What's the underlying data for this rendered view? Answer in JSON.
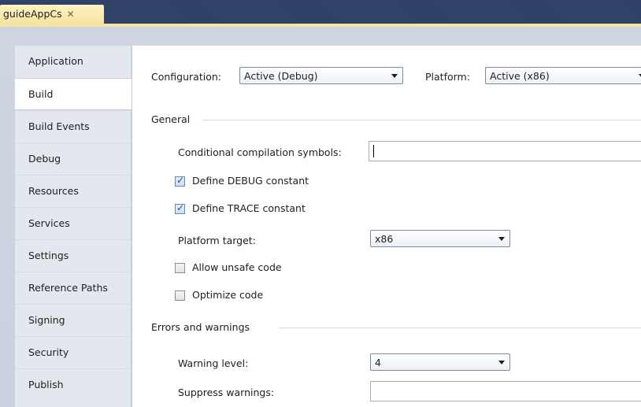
{
  "tab": {
    "title": "guideAppCs",
    "close_glyph": "✕"
  },
  "sidebar": {
    "items": [
      {
        "label": "Application",
        "active": false
      },
      {
        "label": "Build",
        "active": true
      },
      {
        "label": "Build Events",
        "active": false
      },
      {
        "label": "Debug",
        "active": false
      },
      {
        "label": "Resources",
        "active": false
      },
      {
        "label": "Services",
        "active": false
      },
      {
        "label": "Settings",
        "active": false
      },
      {
        "label": "Reference Paths",
        "active": false
      },
      {
        "label": "Signing",
        "active": false
      },
      {
        "label": "Security",
        "active": false
      },
      {
        "label": "Publish",
        "active": false
      }
    ]
  },
  "build": {
    "configuration": {
      "label": "Configuration:",
      "value": "Active (Debug)"
    },
    "platform": {
      "label": "Platform:",
      "value": "Active (x86)"
    },
    "general": {
      "heading": "General",
      "conditional_symbols": {
        "label": "Conditional compilation symbols:",
        "value": ""
      },
      "define_debug": {
        "label": "Define DEBUG constant",
        "checked": true
      },
      "define_trace": {
        "label": "Define TRACE constant",
        "checked": true
      },
      "platform_target": {
        "label": "Platform target:",
        "value": "x86"
      },
      "allow_unsafe": {
        "label": "Allow unsafe code",
        "checked": false
      },
      "optimize": {
        "label": "Optimize code",
        "checked": false
      }
    },
    "errors": {
      "heading": "Errors and warnings",
      "warning_level": {
        "label": "Warning level:",
        "value": "4"
      },
      "suppress_warnings": {
        "label": "Suppress warnings:",
        "value": ""
      }
    }
  },
  "checkmark_glyph": "✓"
}
